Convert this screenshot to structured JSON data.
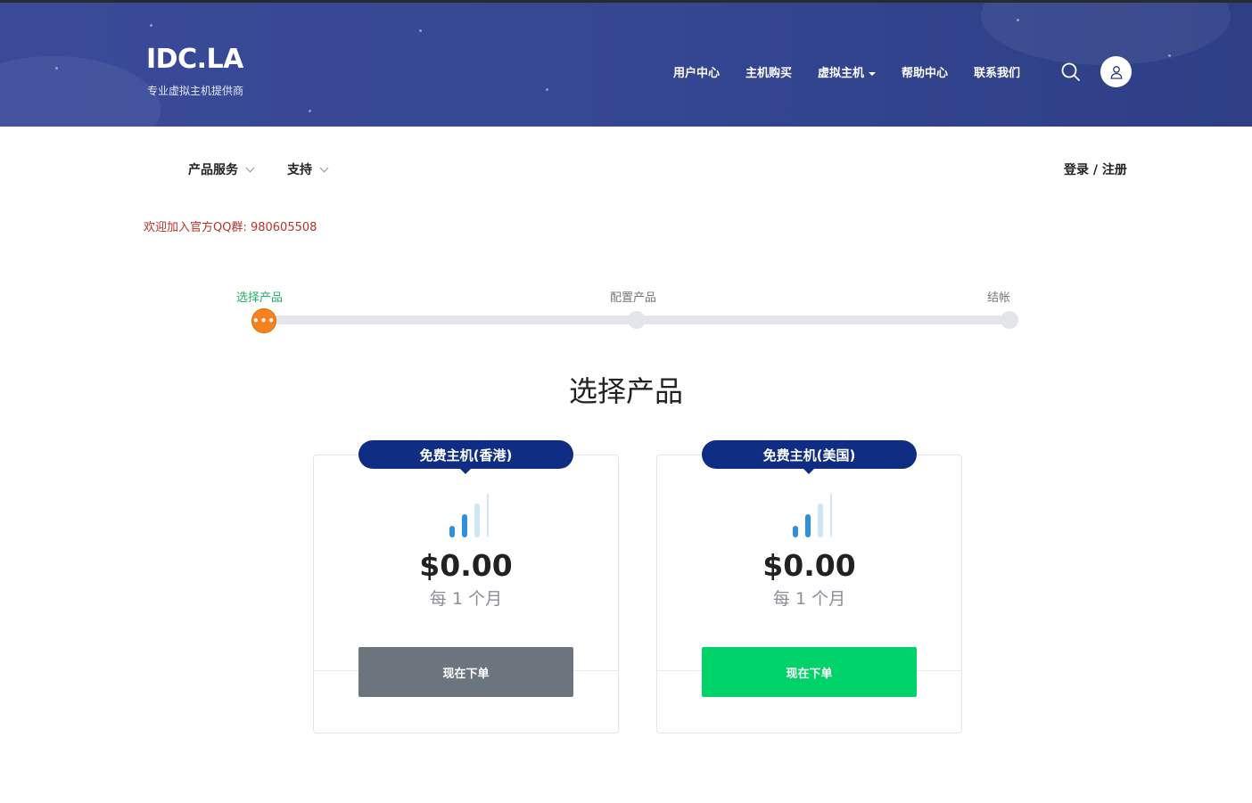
{
  "header": {
    "logo": "IDC.LA",
    "tagline": "专业虚拟主机提供商",
    "nav": [
      {
        "label": "用户中心"
      },
      {
        "label": "主机购买"
      },
      {
        "label": "虚拟主机",
        "has_dropdown": true
      },
      {
        "label": "帮助中心"
      },
      {
        "label": "联系我们"
      }
    ],
    "icons": [
      "search-icon",
      "user-icon"
    ]
  },
  "subnav": {
    "items": [
      {
        "label": "产品服务"
      },
      {
        "label": "支持"
      }
    ],
    "login": "登录 / 注册"
  },
  "notice": "欢迎加入官方QQ群: 980605508",
  "steps": {
    "labels": [
      "选择产品",
      "配置产品",
      "结帐"
    ],
    "current_index": 0,
    "colors": {
      "active_label": "#20b26b",
      "active_dot": "#f5821f",
      "track": "#e3e5ea"
    }
  },
  "page_title": "选择产品",
  "products": [
    {
      "name": "免费主机(香港)",
      "price": "$0.00",
      "period": "每 1 个月",
      "button": "现在下单",
      "button_color": "#6c757d",
      "signal_level": 2
    },
    {
      "name": "免费主机(美国)",
      "price": "$0.00",
      "period": "每 1 个月",
      "button": "现在下单",
      "button_color": "#00d26a",
      "signal_level": 2
    }
  ],
  "colors": {
    "header_bg": "#364794",
    "ribbon_bg": "#0f2d83",
    "notice_text": "#b8322a",
    "signal_active": "#2f8fd8",
    "signal_inactive": "#cfe6f7"
  }
}
